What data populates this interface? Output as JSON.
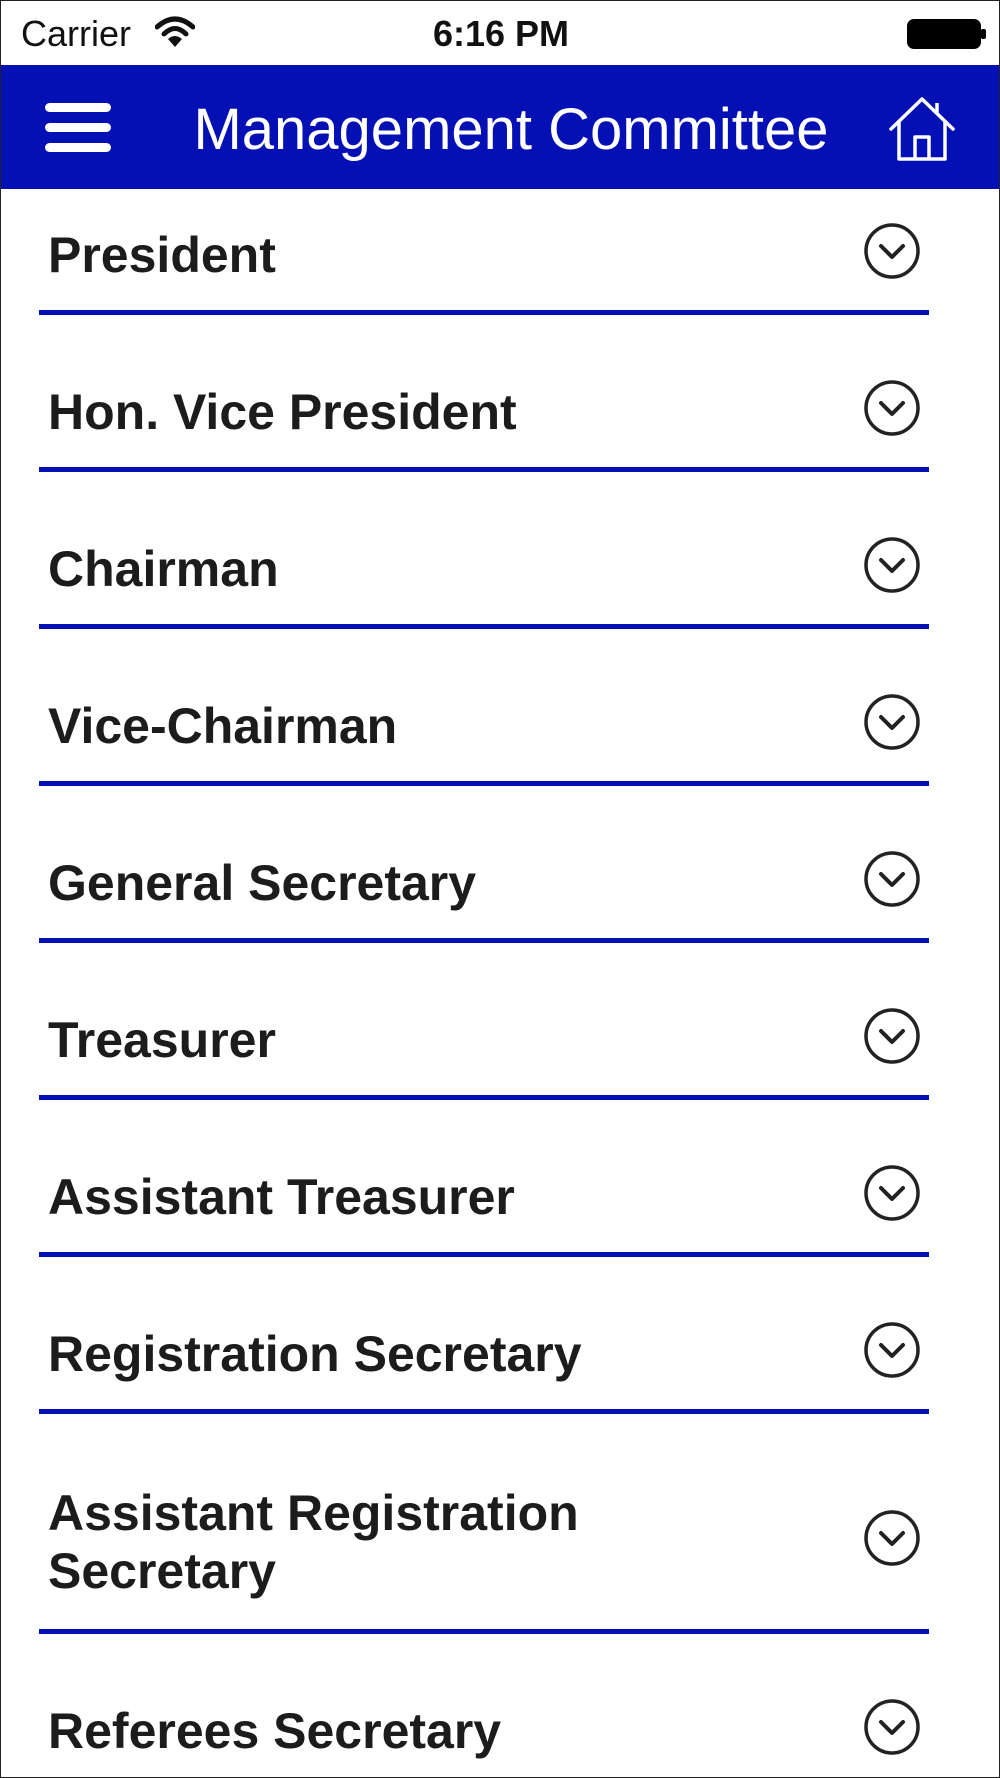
{
  "status_bar": {
    "carrier": "Carrier",
    "time": "6:16 PM",
    "wifi_icon": "wifi-icon",
    "battery_icon": "battery-icon"
  },
  "nav_bar": {
    "title": "Management Committee",
    "menu_icon": "hamburger-menu-icon",
    "home_icon": "home-icon",
    "background_color": "#0510b4"
  },
  "committee_list": {
    "expand_icon": "chevron-down-circle-icon",
    "divider_color": "#0510b4",
    "items": [
      {
        "label": "President"
      },
      {
        "label": "Hon. Vice President"
      },
      {
        "label": "Chairman"
      },
      {
        "label": "Vice-Chairman"
      },
      {
        "label": "General Secretary"
      },
      {
        "label": "Treasurer"
      },
      {
        "label": "Assistant Treasurer"
      },
      {
        "label": "Registration Secretary"
      },
      {
        "label": "Assistant Registration Secretary"
      },
      {
        "label": "Referees Secretary"
      }
    ]
  }
}
